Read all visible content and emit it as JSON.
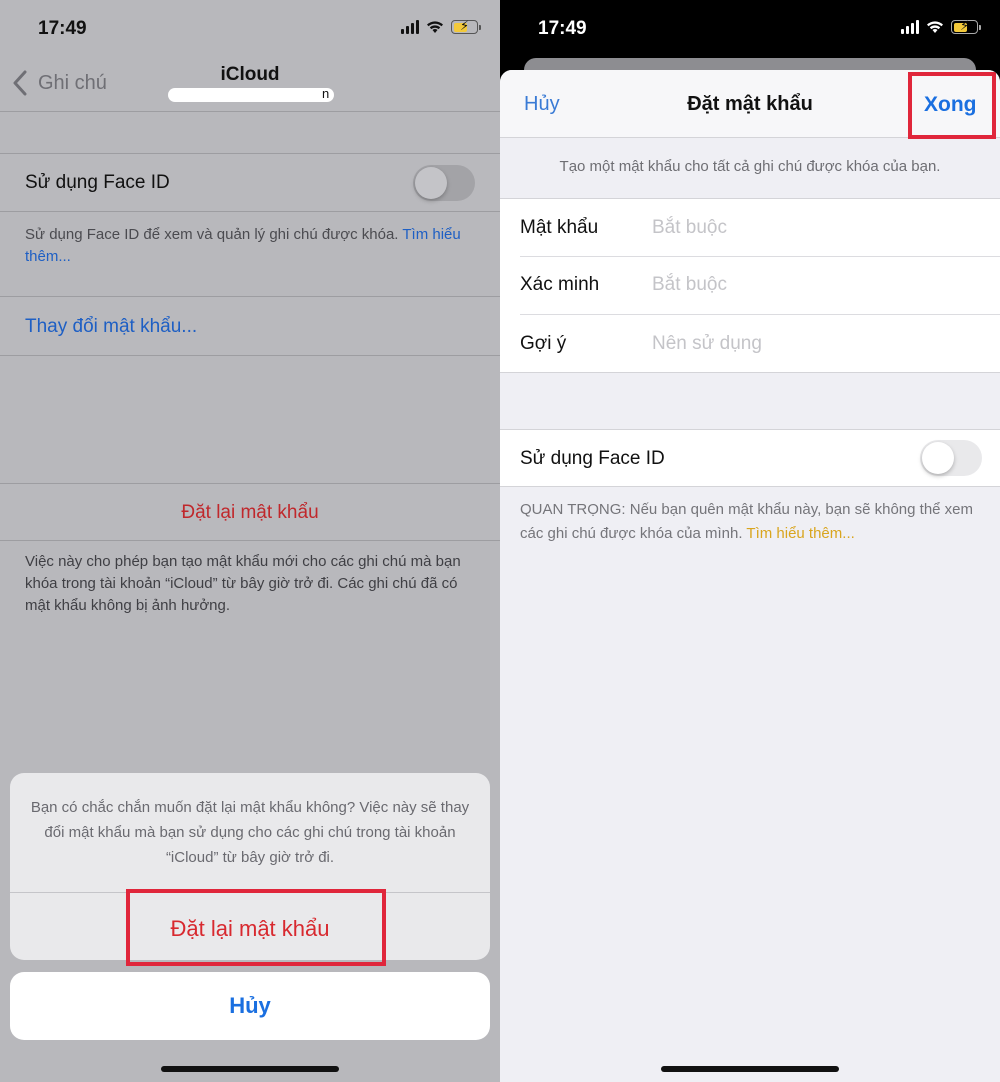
{
  "left": {
    "status": {
      "time": "17:49"
    },
    "nav": {
      "back_label": "Ghi chú",
      "title": "iCloud",
      "subtitle_partial": "n"
    },
    "face_id": {
      "label": "Sử dụng Face ID",
      "description": "Sử dụng Face ID để xem và quản lý ghi chú được khóa.",
      "learn_more": "Tìm hiểu thêm..."
    },
    "change_password": "Thay đổi mật khẩu...",
    "reset": {
      "label": "Đặt lại mật khẩu",
      "description": "Việc này cho phép bạn tạo mật khẩu mới cho các ghi chú mà bạn khóa trong tài khoản “iCloud” từ bây giờ trở đi. Các ghi chú đã có mật khẩu không bị ảnh hưởng."
    },
    "action_sheet": {
      "message": "Bạn có chắc chắn muốn đặt lại mật khẩu không? Việc này sẽ thay đổi mật khẩu mà bạn sử dụng cho các ghi chú trong tài khoản “iCloud” từ bây giờ trở đi.",
      "reset_button": "Đặt lại mật khẩu",
      "cancel_button": "Hủy"
    }
  },
  "right": {
    "status": {
      "time": "17:49"
    },
    "nav": {
      "cancel": "Hủy",
      "title": "Đặt mật khẩu",
      "done": "Xong"
    },
    "info": "Tạo một mật khẩu cho tất cả ghi chú được khóa của bạn.",
    "fields": [
      {
        "label": "Mật khẩu",
        "placeholder": "Bắt buộc"
      },
      {
        "label": "Xác minh",
        "placeholder": "Bắt buộc"
      },
      {
        "label": "Gợi ý",
        "placeholder": "Nên sử dụng"
      }
    ],
    "face_id": {
      "label": "Sử dụng Face ID",
      "note": "QUAN TRỌNG: Nếu bạn quên mật khẩu này, bạn sẽ không thể xem các ghi chú được khóa của mình.",
      "learn_more": "Tìm hiểu thêm..."
    }
  },
  "colors": {
    "accent_blue": "#1a6fe0",
    "destructive_red": "#d8292f",
    "highlight_box": "#e0263b",
    "learn_more_yellow": "#d9a51e"
  }
}
